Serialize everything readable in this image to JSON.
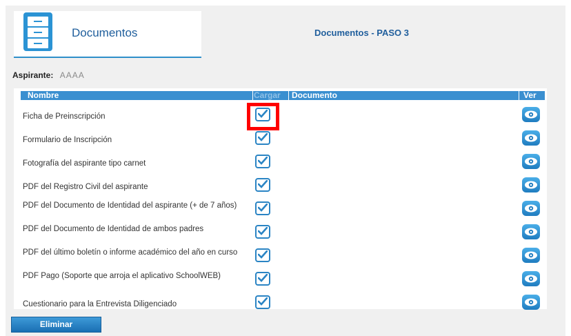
{
  "header": {
    "title": "Documentos",
    "icon": "file-cabinet-icon"
  },
  "step_title": "Documentos - PASO 3",
  "aspirante": {
    "label": "Aspirante:",
    "value": "AAAA"
  },
  "table": {
    "columns": {
      "nombre": "Nombre",
      "cargar": "Cargar",
      "documento": "Documento",
      "ver": "Ver"
    },
    "rows": [
      {
        "name": "Ficha de Preinscripción"
      },
      {
        "name": "Formulario de Inscripción"
      },
      {
        "name": "Fotografía del aspirante tipo carnet"
      },
      {
        "name": "PDF del Registro Civil del aspirante"
      },
      {
        "name": "PDF del Documento de Identidad del aspirante (+ de 7 años)"
      },
      {
        "name": "PDF del Documento de Identidad de ambos padres"
      },
      {
        "name": "PDF del último boletín o informe académico del año en curso"
      },
      {
        "name": "PDF Pago (Soporte que arroja el aplicativo SchoolWEB)"
      },
      {
        "name": "Cuestionario para la Entrevista Diligenciado"
      }
    ],
    "upload_icon": "checkbox-upload-icon",
    "view_icon": "eye-icon"
  },
  "actions": {
    "delete_label": "Eliminar"
  },
  "colors": {
    "accent": "#3a8fd0",
    "highlight": "#ff0000"
  }
}
